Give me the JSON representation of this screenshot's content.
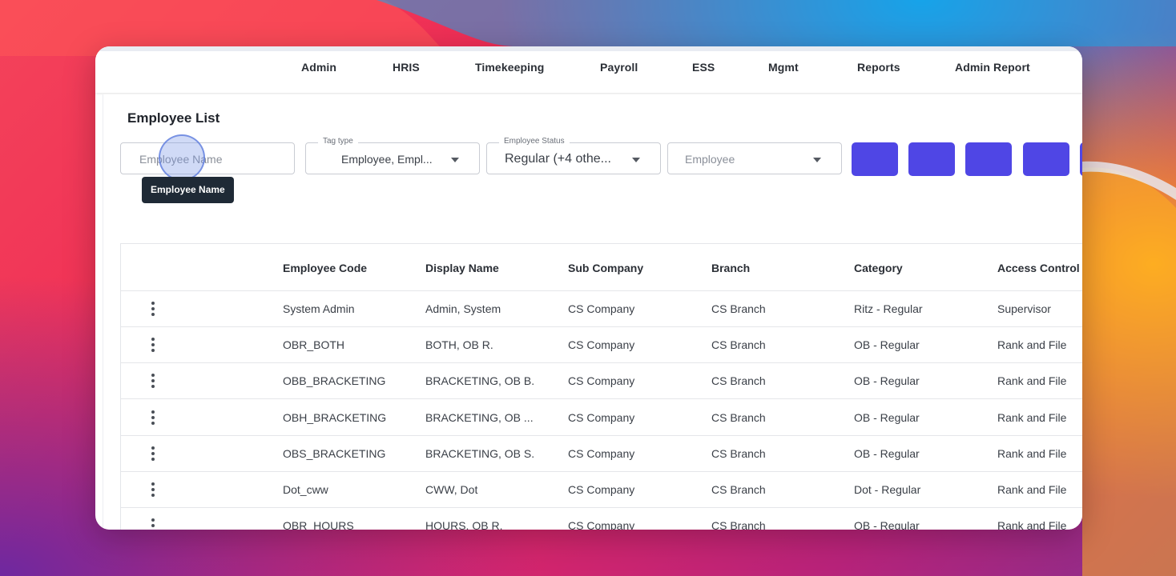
{
  "nav": {
    "items": [
      "Admin",
      "HRIS",
      "Timekeeping",
      "Payroll",
      "ESS",
      "Mgmt",
      "Reports",
      "Admin Report"
    ]
  },
  "page": {
    "title": "Employee List"
  },
  "filters": {
    "name": {
      "placeholder": "Employee Name",
      "value": ""
    },
    "tag_type": {
      "legend": "Tag type",
      "value": "Employee, Empl..."
    },
    "employee_status": {
      "legend": "Employee Status",
      "value": "Regular (+4 othe..."
    },
    "employee": {
      "value": "Employee"
    }
  },
  "tooltip": {
    "text": "Employee Name"
  },
  "action_buttons": {
    "count_visible": 4,
    "color": "#4f46e5"
  },
  "table": {
    "columns": [
      "",
      "Employee Code",
      "Display Name",
      "Sub Company",
      "Branch",
      "Category",
      "Access Control"
    ],
    "rows": [
      [
        "System Admin",
        "Admin, System",
        "CS Company",
        "CS Branch",
        "Ritz - Regular",
        "Supervisor"
      ],
      [
        "OBR_BOTH",
        "BOTH, OB R.",
        "CS Company",
        "CS Branch",
        "OB - Regular",
        "Rank and File"
      ],
      [
        "OBB_BRACKETING",
        "BRACKETING, OB B.",
        "CS Company",
        "CS Branch",
        "OB - Regular",
        "Rank and File"
      ],
      [
        "OBH_BRACKETING",
        "BRACKETING, OB ...",
        "CS Company",
        "CS Branch",
        "OB - Regular",
        "Rank and File"
      ],
      [
        "OBS_BRACKETING",
        "BRACKETING, OB S.",
        "CS Company",
        "CS Branch",
        "OB - Regular",
        "Rank and File"
      ],
      [
        "Dot_cww",
        "CWW, Dot",
        "CS Company",
        "CS Branch",
        "Dot - Regular",
        "Rank and File"
      ],
      [
        "OBR_HOURS",
        "HOURS, OB R.",
        "CS Company",
        "CS Branch",
        "OB - Regular",
        "Rank and File"
      ]
    ]
  },
  "colors": {
    "accent": "#4f46e5",
    "tooltip_bg": "#1f2a36"
  }
}
